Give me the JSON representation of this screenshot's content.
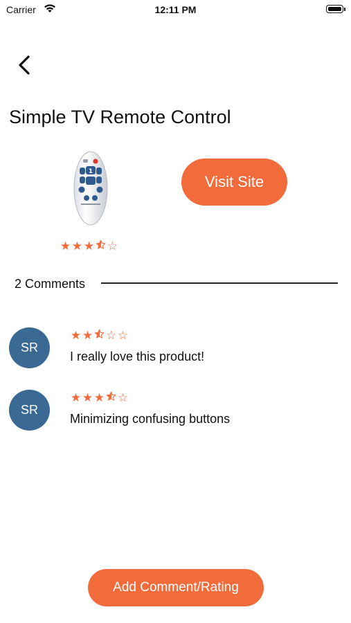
{
  "status_bar": {
    "carrier": "Carrier",
    "time": "12:11 PM"
  },
  "nav": {
    "back_icon": "chevron-left-icon"
  },
  "product": {
    "title": "Simple TV Remote Control",
    "rating": 3.5,
    "image_icon": "tv-remote-image"
  },
  "visit_button": {
    "label": "Visit Site"
  },
  "comments_section": {
    "count_label": "2 Comments"
  },
  "comments": [
    {
      "initials": "SR",
      "rating": 2.5,
      "text": "I really love this product!"
    },
    {
      "initials": "SR",
      "rating": 3.5,
      "text": "Minimizing confusing buttons"
    }
  ],
  "add_comment_button": {
    "label": "Add Comment/Rating"
  },
  "colors": {
    "accent": "#f26b3a",
    "avatar": "#3a6a93"
  }
}
